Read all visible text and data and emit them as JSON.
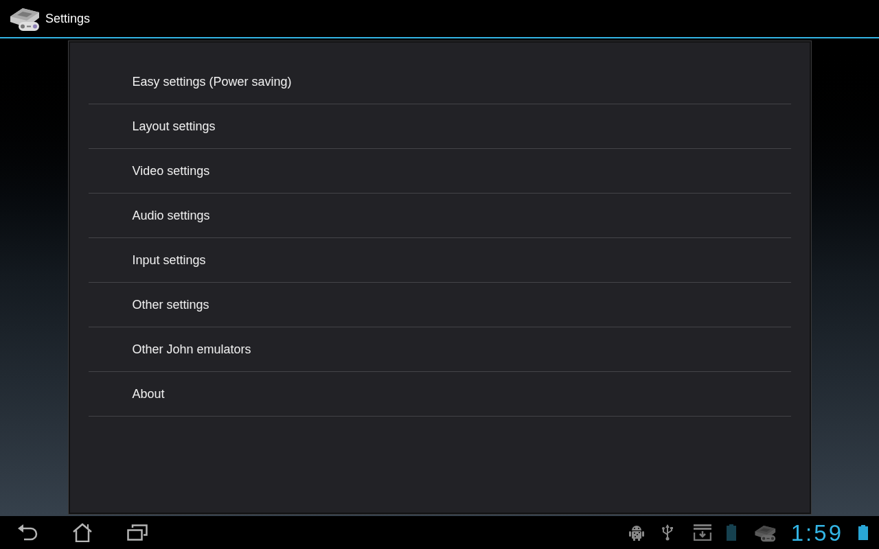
{
  "action_bar": {
    "title": "Settings"
  },
  "settings_list": [
    {
      "label": "Easy settings (Power saving)"
    },
    {
      "label": "Layout settings"
    },
    {
      "label": "Video settings"
    },
    {
      "label": "Audio settings"
    },
    {
      "label": "Input settings"
    },
    {
      "label": "Other settings"
    },
    {
      "label": "Other John emulators"
    },
    {
      "label": "About"
    }
  ],
  "status_bar": {
    "time": "1:59"
  }
}
